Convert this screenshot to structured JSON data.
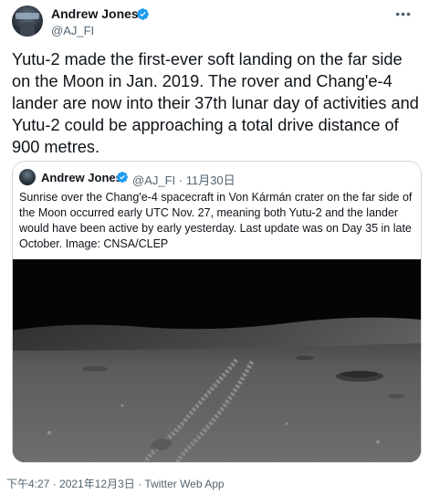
{
  "tweet": {
    "author": {
      "name": "Andrew Jones",
      "handle": "@AJ_FI",
      "verified": true
    },
    "more_icon": "more-horizontal-icon",
    "text": "Yutu-2 made the first-ever soft landing on the far side on the Moon in Jan. 2019. The rover and Chang'e-4 lander are now into their 37th lunar day of activities and Yutu-2 could be approaching a total drive distance of 900 metres.",
    "timestamp": "下午4:27 · 2021年12月3日 · Twitter Web App"
  },
  "quote": {
    "author": {
      "name": "Andrew Jones",
      "handle": "@AJ_FI",
      "verified": true
    },
    "meta": "@AJ_FI · 11月30日",
    "text": "Sunrise over the Chang'e-4 spacecraft in Von Kármán crater on the far side of the Moon occurred early UTC Nov. 27, meaning both Yutu-2 and the lander would have been active by early yesterday. Last update was on Day 35 in late October. Image: CNSA/CLEP",
    "image": "lunar-surface-photo"
  },
  "colors": {
    "text_primary": "#0f1419",
    "text_secondary": "#536471",
    "verified_blue": "#1d9bf0",
    "border": "#cfd9de"
  }
}
